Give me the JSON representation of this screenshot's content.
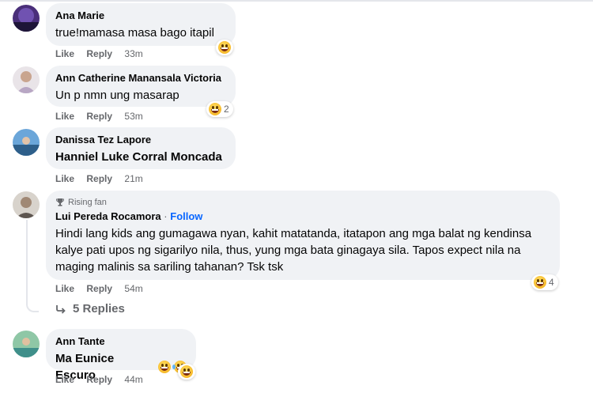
{
  "actions": {
    "like": "Like",
    "reply": "Reply"
  },
  "comments": [
    {
      "author": "Ana Marie",
      "text": "true!mamasa masa bago itapil",
      "time": "33m",
      "reactions_count": ""
    },
    {
      "author": "Ann Catherine Manansala Victoria",
      "text": "Un p nmn ung masarap",
      "time": "53m",
      "reactions_count": "2"
    },
    {
      "author": "Danissa Tez Lapore",
      "text": "Hanniel Luke Corral Moncada",
      "time": "21m",
      "reactions_count": ""
    },
    {
      "badge": "Rising fan",
      "author": "Lui Pereda Rocamora",
      "separator": "·",
      "follow": "Follow",
      "text": "Hindi lang kids ang gumagawa nyan, kahit matatanda, itatapon ang mga balat ng kendinsa kalye pati upos ng sigarilyo nila, thus, yung mga bata ginagaya sila. Tapos expect nila na maging malinis sa sariling tahanan? Tsk tsk",
      "time": "54m",
      "reactions_count": "4",
      "replies_label": "5 Replies"
    },
    {
      "author": "Ann Tante",
      "text": "Ma Eunice Escuro",
      "time": "44m",
      "reactions_count": ""
    }
  ],
  "icons": {
    "reaction": "haha-emoji-icon",
    "badge": "trophy-icon",
    "replies": "reply-arrow-icon"
  },
  "colors": {
    "link": "#0866ff",
    "bubble": "#f0f2f5",
    "meta": "#65676b"
  }
}
